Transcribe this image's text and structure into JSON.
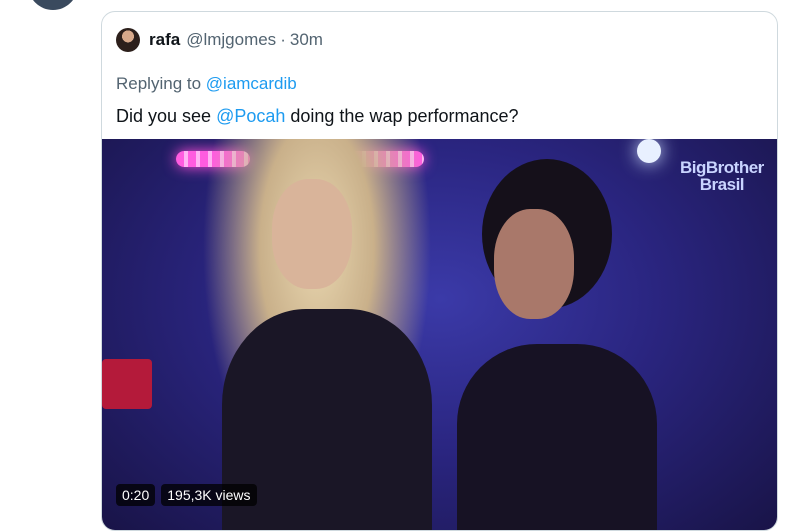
{
  "quoted_tweet": {
    "name": "rafa",
    "handle": "@lmjgomes",
    "separator": "·",
    "time": "30m",
    "replying_prefix": "Replying to ",
    "replying_to": "@iamcardib",
    "text_before": "Did you see ",
    "text_mention": "@Pocah",
    "text_after": " doing the wap performance?"
  },
  "video": {
    "watermark_line1": "BigBrother",
    "watermark_line2": "Brasil",
    "duration": "0:20",
    "views": "195,3K views"
  },
  "colors": {
    "link": "#1d9bf0",
    "secondary_text": "#536471",
    "border": "#cfd9de"
  }
}
